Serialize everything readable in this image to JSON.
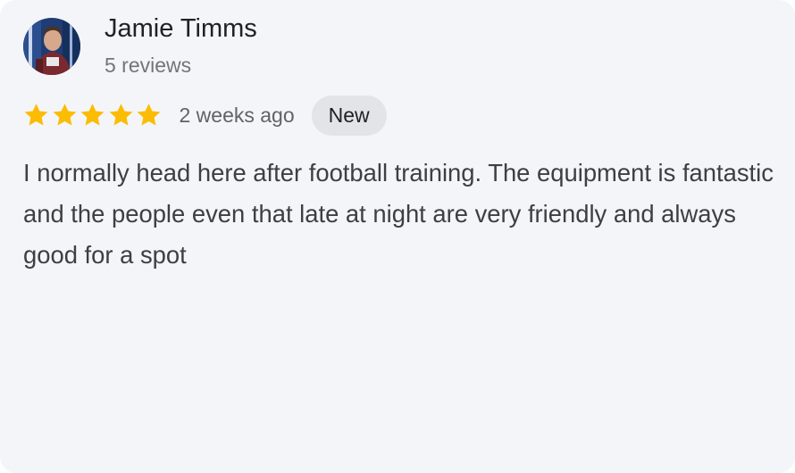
{
  "review": {
    "author": {
      "name": "Jamie Timms",
      "review_count": "5 reviews",
      "avatar_icon": "user-photo-avatar"
    },
    "rating": {
      "stars": 5,
      "max_stars": 5,
      "star_color": "#fbbc04",
      "star_icon": "star-icon"
    },
    "time_ago": "2 weeks ago",
    "badge": "New",
    "text": "I normally head here after football training. The equipment is fantastic and the people even that late at night are very friendly and always good for a spot"
  },
  "colors": {
    "card_background": "#f4f5f8",
    "badge_background": "#e2e4e7",
    "name_text": "#202124",
    "secondary_text": "#70757a",
    "body_text": "#3c4043"
  }
}
